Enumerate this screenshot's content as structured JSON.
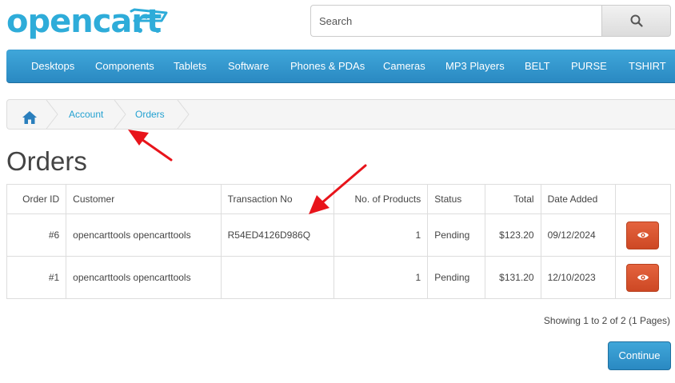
{
  "header": {
    "logo_text": "opencart",
    "search": {
      "placeholder": "Search",
      "value": ""
    }
  },
  "menu": {
    "items": [
      "Desktops",
      "Components",
      "Tablets",
      "Software",
      "Phones & PDAs",
      "Cameras",
      "MP3 Players",
      "BELT",
      "PURSE",
      "TSHIRT"
    ]
  },
  "breadcrumb": {
    "items": [
      "Account",
      "Orders"
    ]
  },
  "page": {
    "title": "Orders"
  },
  "table": {
    "headers": [
      "Order ID",
      "Customer",
      "Transaction No",
      "No. of Products",
      "Status",
      "Total",
      "Date Added",
      ""
    ],
    "rows": [
      {
        "order_id": "#6",
        "customer": "opencarttools opencarttools",
        "transaction_no": "R54ED4126D986Q",
        "products": "1",
        "status": "Pending",
        "total": "$123.20",
        "date_added": "09/12/2024"
      },
      {
        "order_id": "#1",
        "customer": "opencarttools opencarttools",
        "transaction_no": "",
        "products": "1",
        "status": "Pending",
        "total": "$131.20",
        "date_added": "12/10/2023"
      }
    ]
  },
  "pagination": {
    "info": "Showing 1 to 2 of 2 (1 Pages)"
  },
  "actions": {
    "continue_label": "Continue"
  },
  "colors": {
    "brand": "#2eacd9",
    "menu_bg": "#2a89c2",
    "view_button": "#d9532c",
    "annotation_arrow": "#e8141b"
  },
  "icons": {
    "search": "search-icon",
    "home": "home-icon",
    "view": "eye-icon"
  }
}
